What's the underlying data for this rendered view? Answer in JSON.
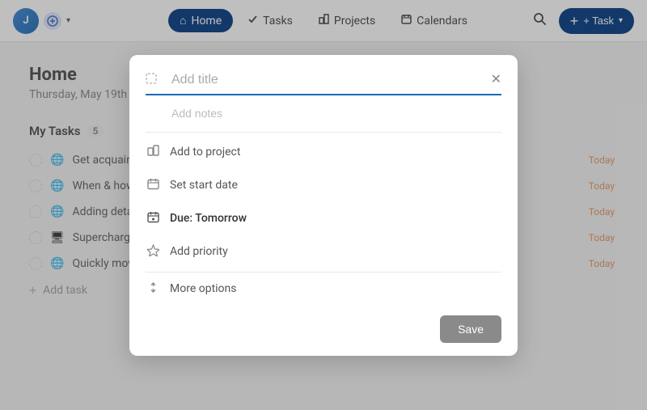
{
  "nav": {
    "avatar_letter": "J",
    "items": [
      {
        "id": "home",
        "label": "Home",
        "icon": "⌂",
        "active": true
      },
      {
        "id": "tasks",
        "label": "Tasks",
        "icon": "✓"
      },
      {
        "id": "projects",
        "label": "Projects",
        "icon": "⚑"
      },
      {
        "id": "calendars",
        "label": "Calendars",
        "icon": "▦"
      }
    ],
    "add_task_label": "+ Task"
  },
  "page": {
    "title": "Home",
    "date": "Thursday, May 19th"
  },
  "my_tasks": {
    "section_title": "My Tasks",
    "badge": "5",
    "tasks": [
      {
        "icon": "🌐",
        "text": "Get acquainted w",
        "due": "Today"
      },
      {
        "icon": "🌐",
        "text": "When & how to c",
        "due": "Today"
      },
      {
        "icon": "🌐",
        "text": "Adding detail to",
        "due": "Today"
      },
      {
        "icon": "🖥",
        "text": "Supercharge tas",
        "due": "Today"
      },
      {
        "icon": "🌐",
        "text": "Quickly move tas",
        "due": "Today"
      }
    ],
    "add_task_label": "Add task"
  },
  "modal": {
    "title_placeholder": "Add title",
    "notes_placeholder": "Add notes",
    "options": [
      {
        "id": "add-to-project",
        "icon": "⚑",
        "label": "Add to project"
      },
      {
        "id": "set-start-date",
        "icon": "▦",
        "label": "Set start date"
      },
      {
        "id": "due-date",
        "icon": "📅",
        "label": "Due: Tomorrow",
        "highlight": true
      },
      {
        "id": "add-priority",
        "icon": "⚡",
        "label": "Add priority"
      }
    ],
    "more_options_label": "More options",
    "more_options_icon": "⇅",
    "close_icon": "✕",
    "save_label": "Save"
  }
}
